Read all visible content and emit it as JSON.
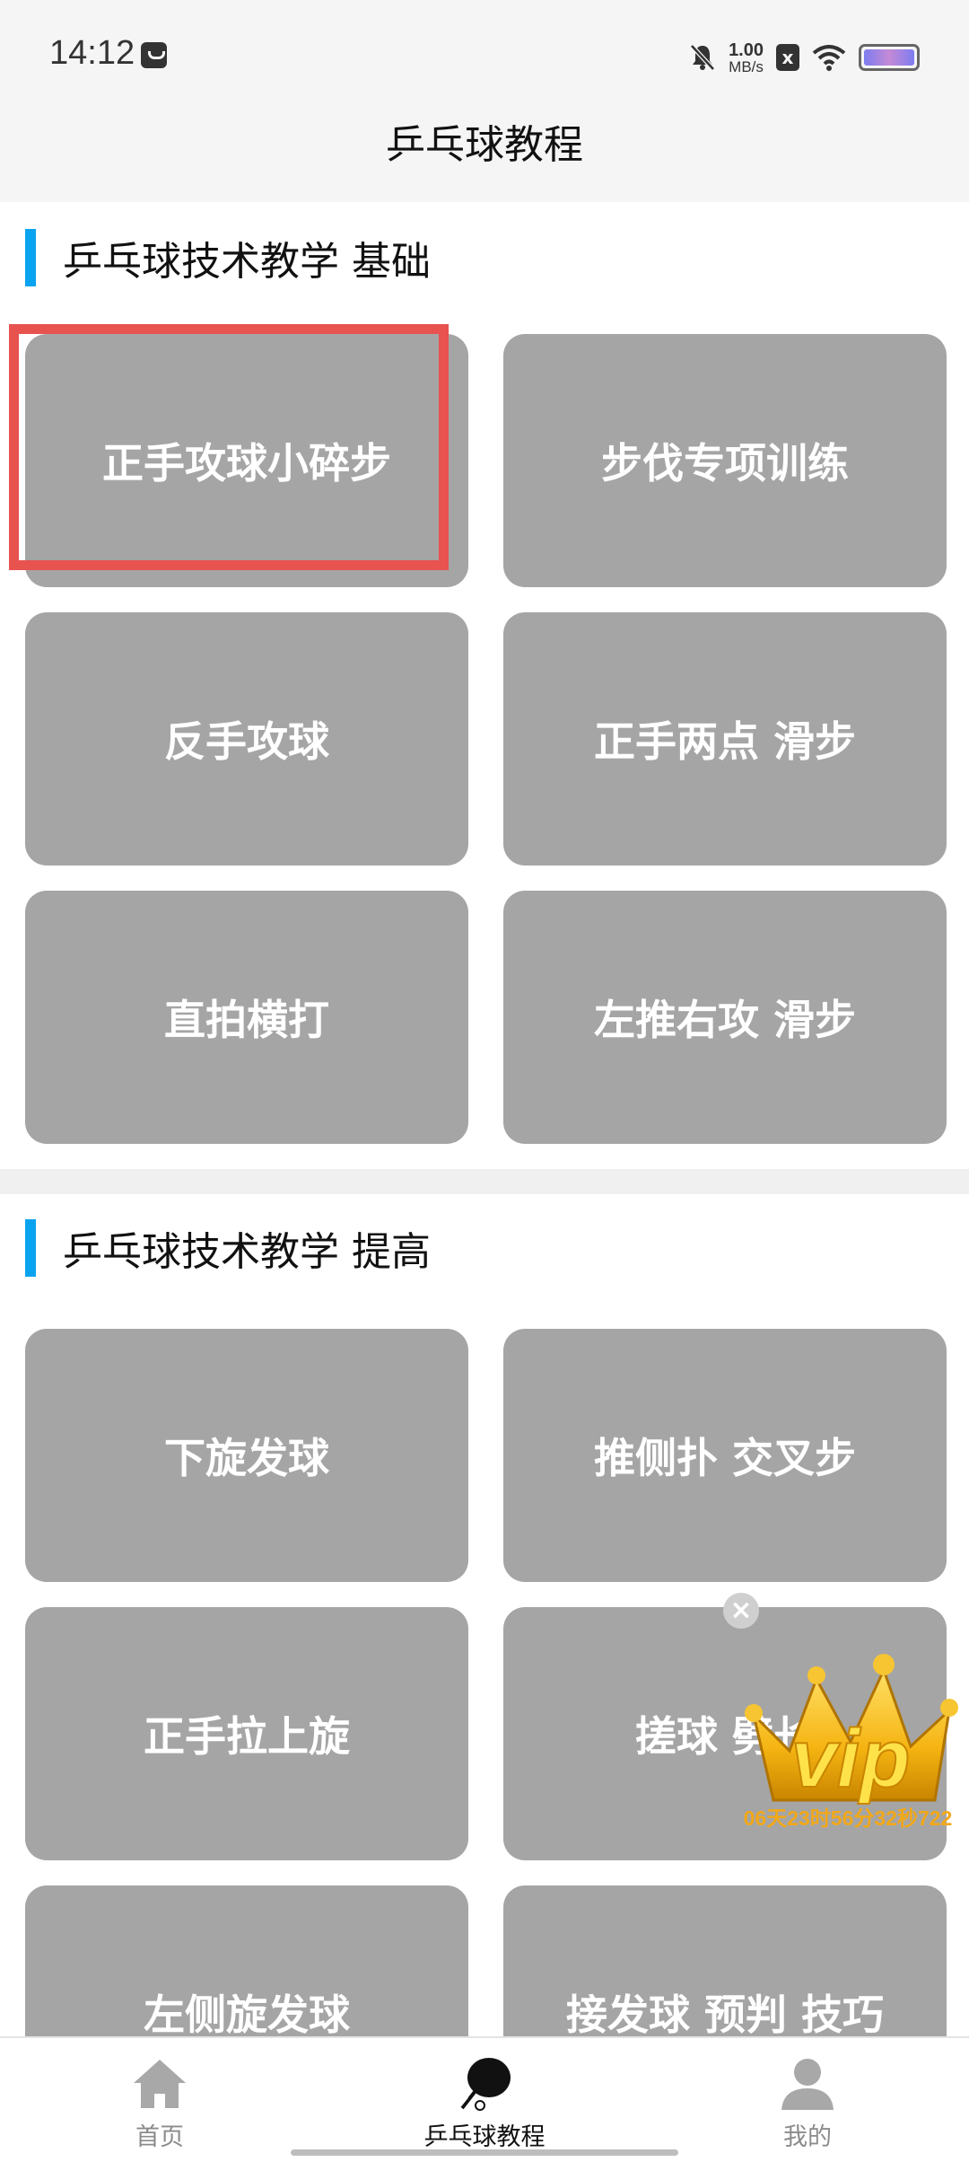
{
  "status_bar": {
    "time": "14:12",
    "net_speed_value": "1.00",
    "net_speed_unit": "MB/s",
    "sim_icon": "x"
  },
  "header": {
    "title": "乒乓球教程"
  },
  "sections": [
    {
      "title": "乒乓球技术教学 基础",
      "cards": [
        "正手攻球小碎步",
        "步伐专项训练",
        "反手攻球",
        "正手两点 滑步",
        "直拍横打",
        "左推右攻 滑步"
      ]
    },
    {
      "title": "乒乓球技术教学 提高",
      "cards": [
        "下旋发球",
        "推侧扑 交叉步",
        "正手拉上旋",
        "搓球 劈长",
        "左侧旋发球",
        "接发球 预判 技巧"
      ]
    }
  ],
  "vip": {
    "close": "×",
    "text": "vip",
    "countdown": "06天23时56分32秒722"
  },
  "bottom_nav": {
    "items": [
      {
        "label": "首页",
        "icon": "home-icon"
      },
      {
        "label": "乒乓球教程",
        "icon": "ping-pong-paddle-icon"
      },
      {
        "label": "我的",
        "icon": "user-icon"
      }
    ]
  },
  "colors": {
    "accent": "#0aa3ef",
    "card": "#a5a5a5",
    "highlight": "#e8524f",
    "vip_gold": "#f2a818"
  }
}
